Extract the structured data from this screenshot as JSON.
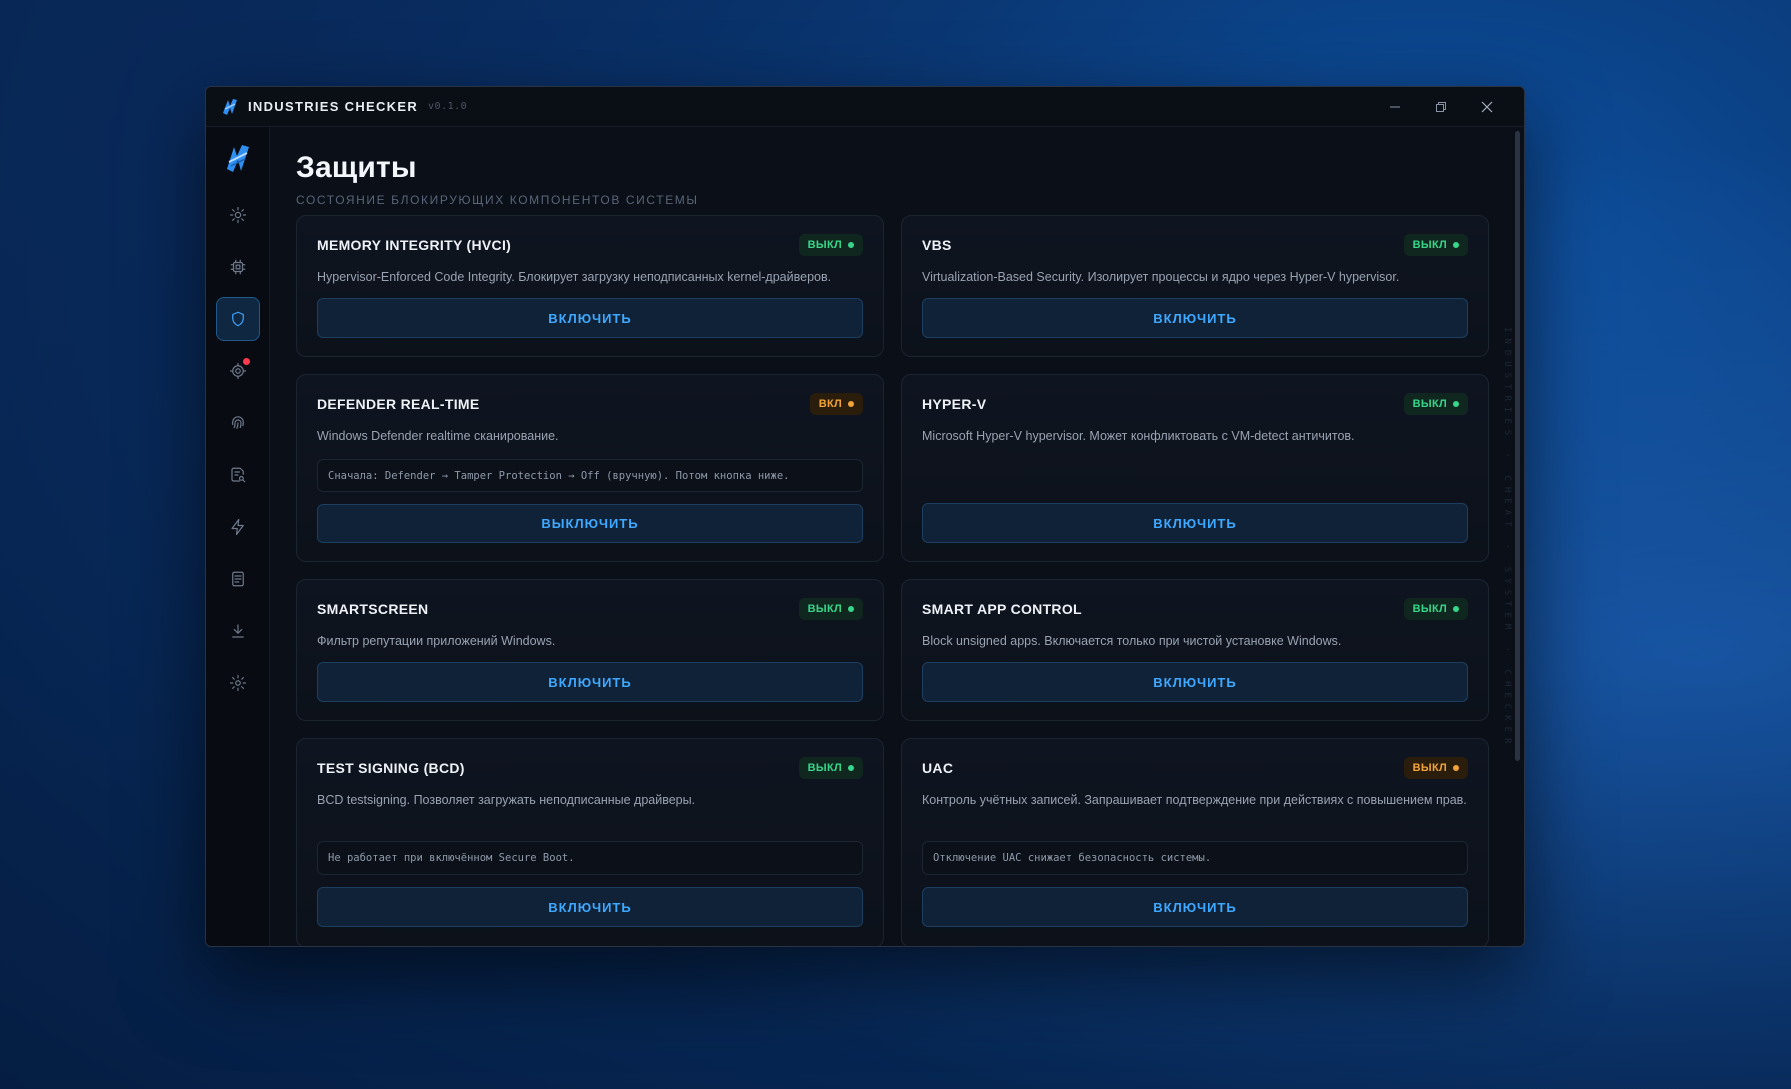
{
  "window": {
    "title": "INDUSTRIES CHECKER",
    "version": "v0.1.0"
  },
  "sidebar": {
    "items": [
      {
        "icon": "sun-icon"
      },
      {
        "icon": "chip-icon"
      },
      {
        "icon": "shield-icon",
        "active": true
      },
      {
        "icon": "target-icon",
        "badge": true
      },
      {
        "icon": "fingerprint-icon"
      },
      {
        "icon": "search-doc-icon"
      },
      {
        "icon": "bolt-icon"
      },
      {
        "icon": "document-icon"
      },
      {
        "icon": "download-icon"
      },
      {
        "icon": "settings-icon"
      }
    ]
  },
  "page": {
    "title": "Защиты",
    "subtitle": "СОСТОЯНИЕ БЛОКИРУЮЩИХ КОМПОНЕНТОВ СИСТЕМЫ",
    "side_text": "INDUSTRIES · CHEAT · SYSTEM · CHECKER"
  },
  "cards": [
    {
      "title": "MEMORY INTEGRITY (HVCI)",
      "status": "ВЫКЛ",
      "desc": "Hypervisor-Enforced Code Integrity. Блокирует загрузку неподписанных kernel-драйверов.",
      "button": "ВКЛЮЧИТЬ"
    },
    {
      "title": "VBS",
      "status": "ВЫКЛ",
      "desc": "Virtualization-Based Security. Изолирует процессы и ядро через Hyper-V hypervisor.",
      "button": "ВКЛЮЧИТЬ"
    },
    {
      "title": "DEFENDER REAL-TIME",
      "status": "ВКЛ",
      "desc": "Windows Defender realtime сканирование.",
      "note": "Сначала: Defender → Tamper Protection → Off (вручную). Потом кнопка ниже.",
      "button": "ВЫКЛЮЧИТЬ"
    },
    {
      "title": "HYPER-V",
      "status": "ВЫКЛ",
      "desc": "Microsoft Hyper-V hypervisor. Может конфликтовать с VM-detect античитов.",
      "button": "ВКЛЮЧИТЬ"
    },
    {
      "title": "SMARTSCREEN",
      "status": "ВЫКЛ",
      "desc": "Фильтр репутации приложений Windows.",
      "button": "ВКЛЮЧИТЬ"
    },
    {
      "title": "SMART APP CONTROL",
      "status": "ВЫКЛ",
      "desc": "Block unsigned apps. Включается только при чистой установке Windows.",
      "button": "ВКЛЮЧИТЬ"
    },
    {
      "title": "TEST SIGNING (BCD)",
      "status": "ВЫКЛ",
      "desc": "BCD testsigning. Позволяет загружать неподписанные драйверы.",
      "note": "Не работает при включённом Secure Boot.",
      "button": "ВКЛЮЧИТЬ"
    },
    {
      "title": "UAC",
      "status": "ВЫКЛ",
      "desc": "Контроль учётных записей. Запрашивает подтверждение при действиях с повышением прав.",
      "note": "Отключение UAC снижает безопасность системы.",
      "button": "ВКЛЮЧИТЬ"
    }
  ],
  "colors": {
    "accent": "#3fa9ff",
    "status_off": "#38d68a",
    "status_on": "#f2a43a",
    "notification": "#ff3b4e"
  }
}
